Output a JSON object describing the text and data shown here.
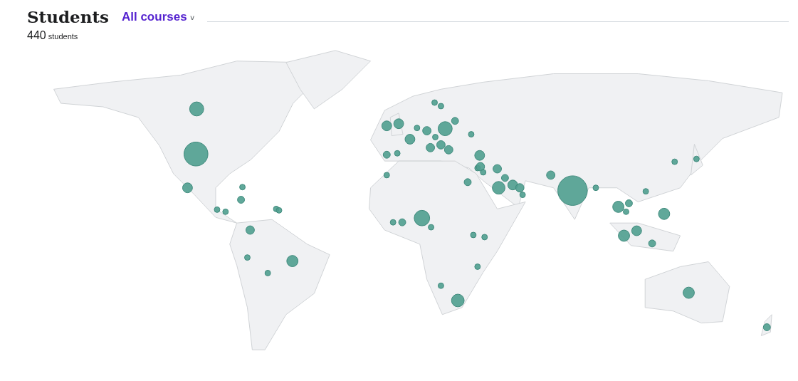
{
  "header": {
    "title": "Students",
    "filter": {
      "label": "All courses",
      "caret": "˅"
    }
  },
  "summary": {
    "count": "440",
    "unit": "students"
  }
}
